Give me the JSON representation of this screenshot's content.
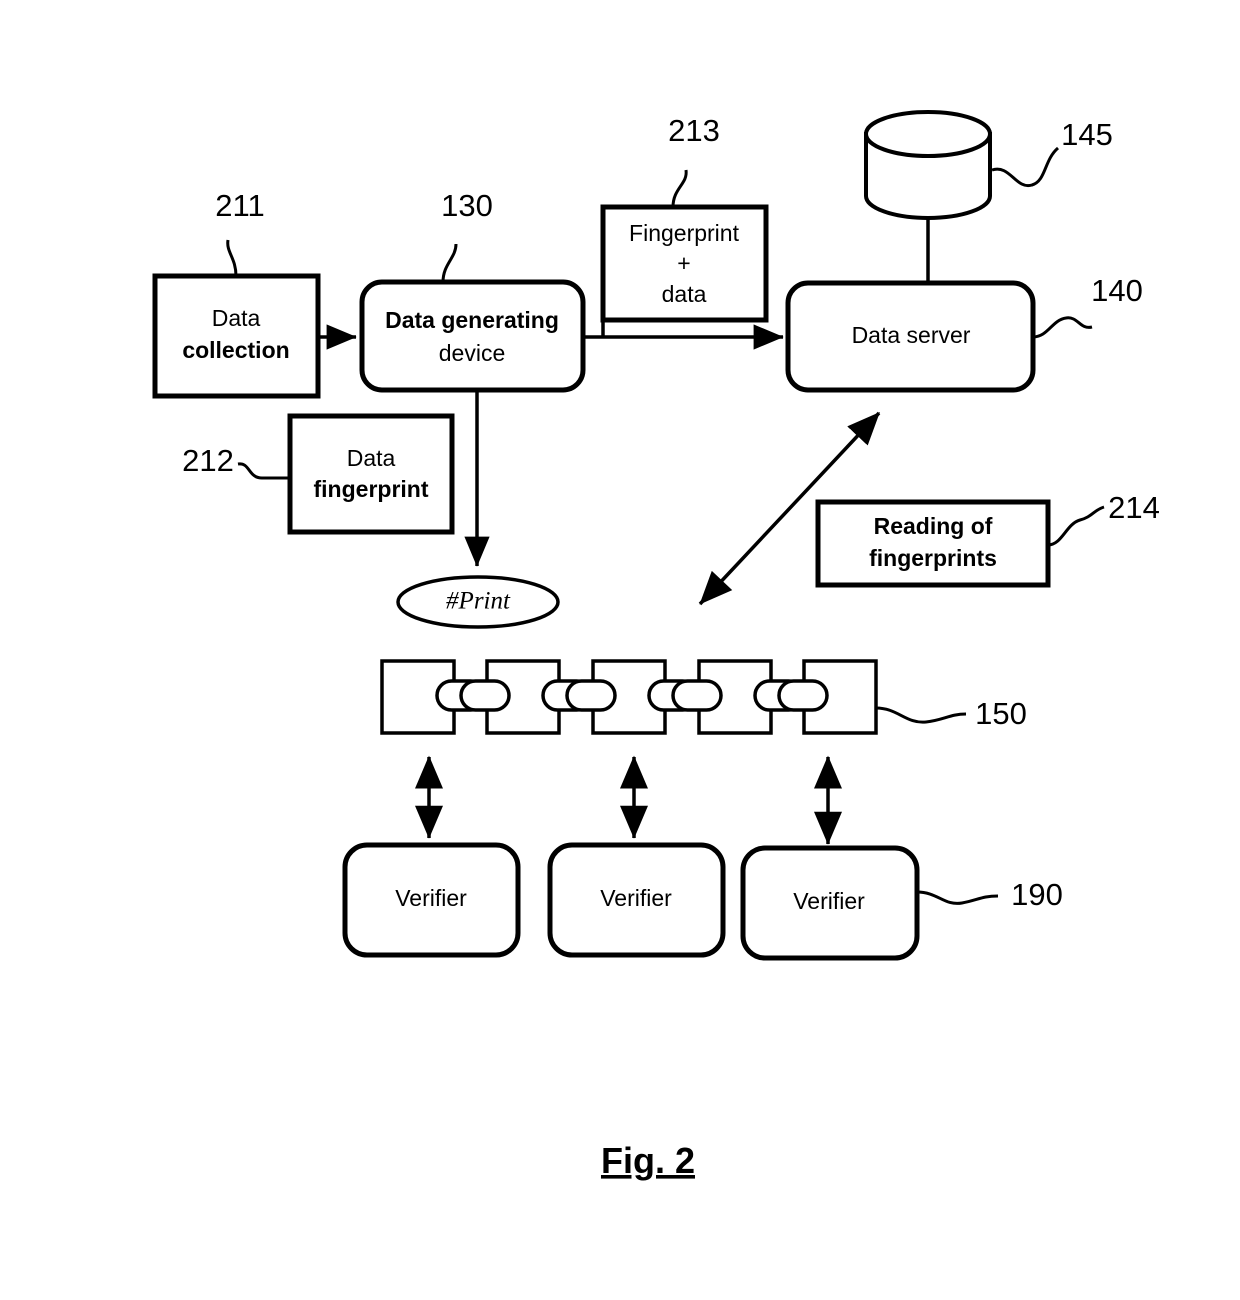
{
  "figure": {
    "caption": "Fig. 2",
    "type": "patent-block-diagram"
  },
  "nodes": {
    "data_collection": {
      "ref": "211",
      "line1": "Data",
      "line2": "collection",
      "shape": "rectangle"
    },
    "data_generating_device": {
      "ref": "130",
      "line1": "Data generating",
      "line2": "device",
      "shape": "rounded-rectangle"
    },
    "fingerprint_plus_data": {
      "ref": "213",
      "line1": "Fingerprint",
      "line2": "+",
      "line3": "data",
      "shape": "rectangle"
    },
    "data_server": {
      "ref": "140",
      "line1": "Data server",
      "shape": "rounded-rectangle"
    },
    "database": {
      "ref": "145",
      "shape": "cylinder"
    },
    "data_fingerprint": {
      "ref": "212",
      "line1": "Data",
      "line2": "fingerprint",
      "shape": "rectangle"
    },
    "print_token": {
      "label": "#Print",
      "shape": "ellipse"
    },
    "reading_of_fingerprints": {
      "ref": "214",
      "line1": "Reading of",
      "line2": "fingerprints",
      "shape": "rectangle"
    },
    "blockchain": {
      "ref": "150",
      "block_count": 5,
      "link_count": 4,
      "shape": "chain-of-blocks"
    },
    "verifiers": {
      "ref": "190",
      "label": "Verifier",
      "count": 3,
      "shape": "rounded-rectangle"
    }
  },
  "connections": [
    {
      "name": "collection-to-device",
      "from": "data_collection",
      "to": "data_generating_device",
      "style": "single-arrow"
    },
    {
      "name": "device-to-server",
      "from": "data_generating_device",
      "to": "data_server",
      "style": "single-arrow"
    },
    {
      "name": "device-to-print",
      "from": "data_generating_device",
      "to": "print_token",
      "style": "single-arrow"
    },
    {
      "name": "database-to-server",
      "from": "database",
      "to": "data_server",
      "style": "plain-line"
    },
    {
      "name": "server-to-blockchain",
      "from": "data_server",
      "to": "blockchain",
      "style": "double-arrow"
    },
    {
      "name": "blockchain-to-verifier-1",
      "from": "blockchain",
      "to": "verifiers",
      "style": "double-arrow"
    },
    {
      "name": "blockchain-to-verifier-2",
      "from": "blockchain",
      "to": "verifiers",
      "style": "double-arrow"
    },
    {
      "name": "blockchain-to-verifier-3",
      "from": "blockchain",
      "to": "verifiers",
      "style": "double-arrow"
    }
  ],
  "colors": {
    "stroke": "#000000",
    "fill": "#ffffff",
    "text": "#000000"
  }
}
